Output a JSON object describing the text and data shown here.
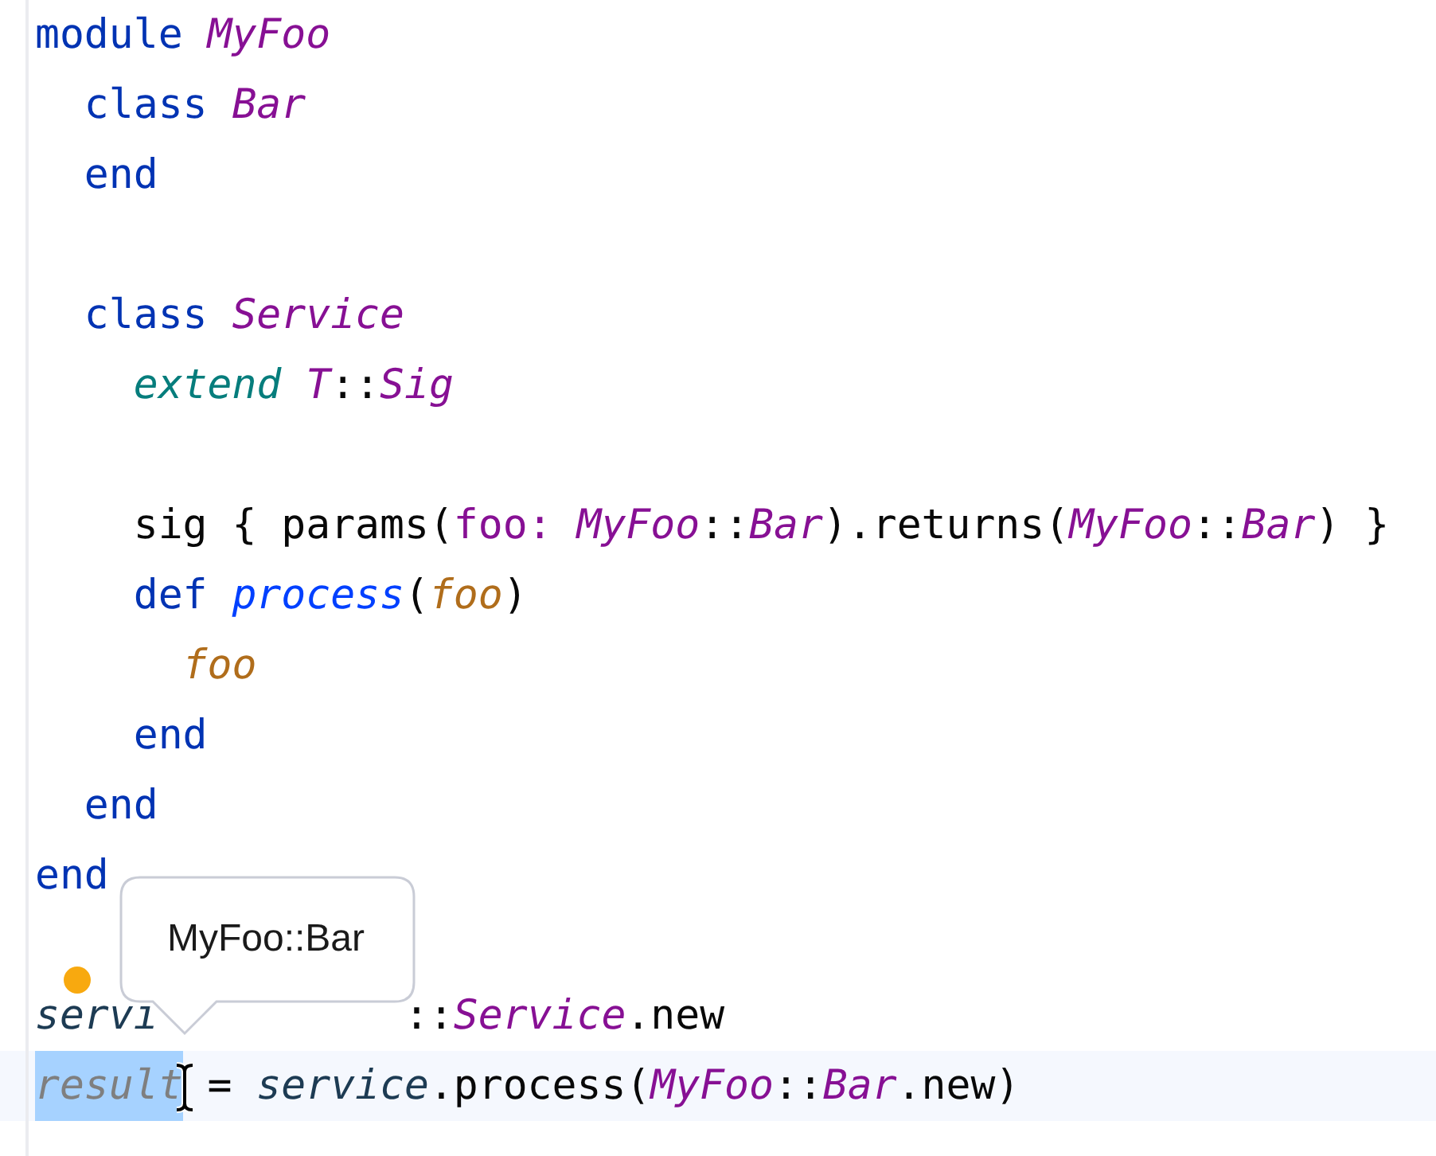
{
  "editor": {
    "lines": [
      {
        "kind": "code",
        "tokens": [
          {
            "text": "module",
            "kind": "keyword"
          },
          {
            "text": "MyFoo",
            "kind": "constant",
            "gap": true
          }
        ],
        "children": [
          {
            "kind": "code",
            "tokens": [
              {
                "text": "class",
                "kind": "keyword"
              },
              {
                "text": "Bar",
                "kind": "constant",
                "gap": true
              }
            ]
          },
          {
            "kind": "code",
            "tokens": [
              {
                "text": "end",
                "kind": "keyword"
              }
            ]
          },
          {
            "kind": "blank"
          },
          {
            "kind": "code",
            "tokens": [
              {
                "text": "class",
                "kind": "keyword"
              },
              {
                "text": "Service",
                "kind": "constant",
                "gap": true
              }
            ],
            "children": [
              {
                "kind": "code",
                "tokens": [
                  {
                    "text": "extend",
                    "kind": "builtin"
                  },
                  {
                    "text": "T",
                    "kind": "constant",
                    "gap": true
                  },
                  {
                    "text": "::",
                    "kind": "plain"
                  },
                  {
                    "text": "Sig",
                    "kind": "constant"
                  }
                ]
              },
              {
                "kind": "blank"
              },
              {
                "kind": "code",
                "tokens": [
                  {
                    "text": "sig { params(",
                    "kind": "plain"
                  },
                  {
                    "text": "foo:",
                    "kind": "symbol"
                  },
                  {
                    "text": "MyFoo",
                    "kind": "constant",
                    "gap": true
                  },
                  {
                    "text": "::",
                    "kind": "plain"
                  },
                  {
                    "text": "Bar",
                    "kind": "constant"
                  },
                  {
                    "text": ").returns(",
                    "kind": "plain"
                  },
                  {
                    "text": "MyFoo",
                    "kind": "constant"
                  },
                  {
                    "text": "::",
                    "kind": "plain"
                  },
                  {
                    "text": "Bar",
                    "kind": "constant"
                  },
                  {
                    "text": ") }",
                    "kind": "plain"
                  }
                ]
              },
              {
                "kind": "code",
                "tokens": [
                  {
                    "text": "def",
                    "kind": "keyword"
                  },
                  {
                    "text": "process",
                    "kind": "method",
                    "gap": true
                  },
                  {
                    "text": "(",
                    "kind": "plain"
                  },
                  {
                    "text": "foo",
                    "kind": "param"
                  },
                  {
                    "text": ")",
                    "kind": "plain"
                  }
                ],
                "children": [
                  {
                    "kind": "code",
                    "tokens": [
                      {
                        "text": "foo",
                        "kind": "param"
                      }
                    ]
                  }
                ]
              },
              {
                "kind": "code",
                "tokens": [
                  {
                    "text": "end",
                    "kind": "keyword"
                  }
                ]
              }
            ]
          },
          {
            "kind": "code",
            "tokens": [
              {
                "text": "end",
                "kind": "keyword"
              }
            ]
          }
        ]
      },
      {
        "kind": "code",
        "tokens": [
          {
            "text": "end",
            "kind": "keyword"
          }
        ]
      },
      {
        "kind": "blank"
      },
      {
        "kind": "code",
        "covered": true,
        "bulb": true,
        "tokens": [
          {
            "text": "servi",
            "kind": "variable"
          },
          {
            "text": "::",
            "kind": "plain"
          },
          {
            "text": "Service",
            "kind": "constant"
          },
          {
            "text": ".new",
            "kind": "plain"
          }
        ]
      },
      {
        "kind": "code",
        "current": true,
        "mouse_pointer": true,
        "tokens": [
          {
            "text": "result",
            "kind": "unused",
            "selected": true
          },
          {
            "text": "=",
            "kind": "plain",
            "gap": true
          },
          {
            "text": "service",
            "kind": "variable",
            "gap": true
          },
          {
            "text": ".process(",
            "kind": "plain"
          },
          {
            "text": "MyFoo",
            "kind": "constant"
          },
          {
            "text": "::",
            "kind": "plain"
          },
          {
            "text": "Bar",
            "kind": "constant"
          },
          {
            "text": ".new)",
            "kind": "plain"
          }
        ]
      }
    ]
  },
  "tooltip": {
    "text": "MyFoo::Bar"
  }
}
